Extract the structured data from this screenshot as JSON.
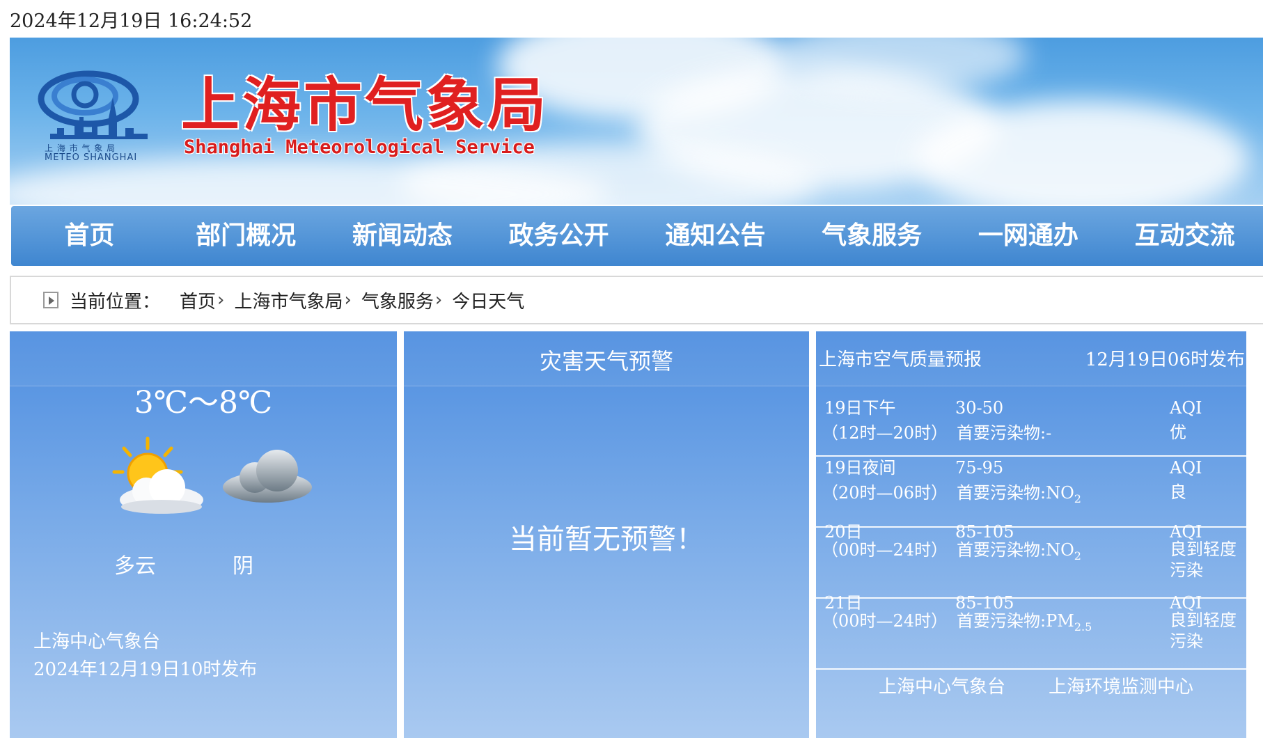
{
  "timestamp": "2024年12月19日  16:24:52",
  "header": {
    "logo_caption_cn": "上 海 市 气 象 局",
    "logo_caption_en": "METEO SHANGHAI",
    "title_cn": "上海市气象局",
    "title_en": "Shanghai Meteorological Service"
  },
  "nav": [
    "首页",
    "部门概况",
    "新闻动态",
    "政务公开",
    "通知公告",
    "气象服务",
    "一网通办",
    "互动交流"
  ],
  "breadcrumb": {
    "label": "当前位置：",
    "items": [
      "首页",
      "上海市气象局",
      "气象服务",
      "今日天气"
    ],
    "separator": "›"
  },
  "forecast": {
    "temperature": "3℃～8℃",
    "conditions": [
      {
        "label": "多云",
        "icon": "partly-cloudy-icon"
      },
      {
        "label": "阴",
        "icon": "overcast-cloud-icon"
      }
    ],
    "issuer": "上海中心气象台",
    "issued": "2024年12月19日10时发布"
  },
  "warning": {
    "title": "灾害天气预警",
    "message": "当前暂无预警！"
  },
  "air_quality": {
    "title": "上海市空气质量预报",
    "published": "12月19日06时发布",
    "rows": [
      {
        "day": "19日下午",
        "period": "（12时—20时）",
        "range": "30-50",
        "pollutant_label": "首要污染物:",
        "pollutant": "-",
        "pollutant_sub": "",
        "aqi": "AQI",
        "level": "优"
      },
      {
        "day": "19日夜间",
        "period": "（20时—06时）",
        "range": "75-95",
        "pollutant_label": "首要污染物:",
        "pollutant": "NO",
        "pollutant_sub": "2",
        "aqi": "AQI",
        "level": "良"
      },
      {
        "day": "20日",
        "period": "（00时—24时）",
        "range": "85-105",
        "pollutant_label": "首要污染物:",
        "pollutant": "NO",
        "pollutant_sub": "2",
        "aqi": "AQI",
        "level": "良到轻度污染"
      },
      {
        "day": "21日",
        "period": "（00时—24时）",
        "range": "85-105",
        "pollutant_label": "首要污染物:",
        "pollutant": "PM",
        "pollutant_sub": "2.5",
        "aqi": "AQI",
        "level": "良到轻度污染"
      }
    ],
    "footer": [
      "上海中心气象台",
      "上海环境监测中心"
    ]
  },
  "colors": {
    "nav_blue": "#4a8fd8",
    "title_red": "#e02020",
    "panel_blue": "#5b96e2"
  }
}
